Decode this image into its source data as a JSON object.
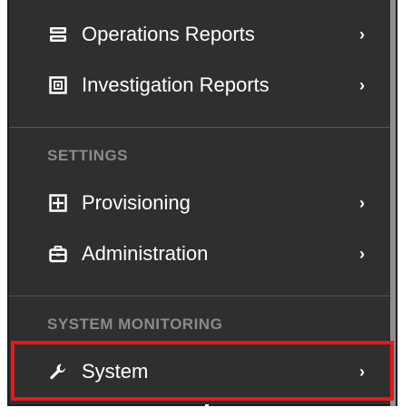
{
  "menu": {
    "items_top": [
      {
        "label": "Operations Reports",
        "icon": "server-icon",
        "chevron": "›"
      },
      {
        "label": "Investigation Reports",
        "icon": "report-icon",
        "chevron": "›"
      }
    ],
    "settings_header": "SETTINGS",
    "settings_items": [
      {
        "label": "Provisioning",
        "icon": "grid-plus-icon",
        "chevron": "›"
      },
      {
        "label": "Administration",
        "icon": "briefcase-icon",
        "chevron": "›"
      }
    ],
    "system_monitoring_header": "SYSTEM MONITORING",
    "system_items": [
      {
        "label": "System",
        "icon": "wrench-icon",
        "chevron": "›"
      }
    ]
  },
  "colors": {
    "background": "#2f2f2f",
    "text": "#ffffff",
    "section_header": "#8b8b8b",
    "highlight": "#e01b1b"
  }
}
